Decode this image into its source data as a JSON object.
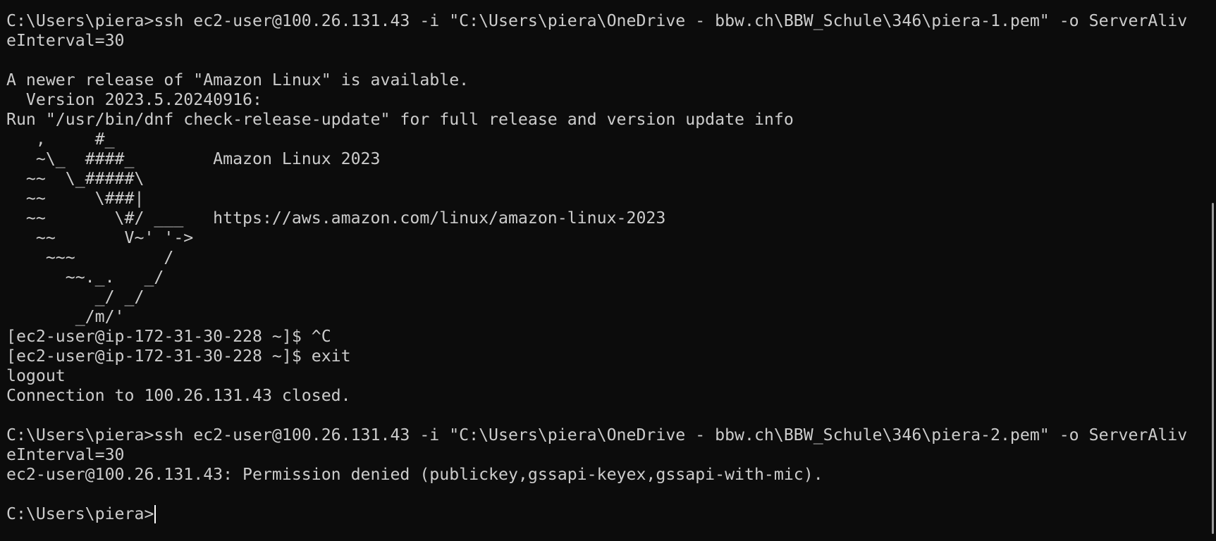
{
  "terminal": {
    "lines": [
      "C:\\Users\\piera>ssh ec2-user@100.26.131.43 -i \"C:\\Users\\piera\\OneDrive - bbw.ch\\BBW_Schule\\346\\piera-1.pem\" -o ServerAliv",
      "eInterval=30",
      "",
      "A newer release of \"Amazon Linux\" is available.",
      "  Version 2023.5.20240916:",
      "Run \"/usr/bin/dnf check-release-update\" for full release and version update info",
      "   ,     #_",
      "   ~\\_  ####_        Amazon Linux 2023",
      "  ~~  \\_#####\\",
      "  ~~     \\###|",
      "  ~~       \\#/ ___   https://aws.amazon.com/linux/amazon-linux-2023",
      "   ~~       V~' '->",
      "    ~~~         /",
      "      ~~._.   _/",
      "         _/ _/",
      "       _/m/'",
      "[ec2-user@ip-172-31-30-228 ~]$ ^C",
      "[ec2-user@ip-172-31-30-228 ~]$ exit",
      "logout",
      "Connection to 100.26.131.43 closed.",
      "",
      "C:\\Users\\piera>ssh ec2-user@100.26.131.43 -i \"C:\\Users\\piera\\OneDrive - bbw.ch\\BBW_Schule\\346\\piera-2.pem\" -o ServerAliv",
      "eInterval=30",
      "ec2-user@100.26.131.43: Permission denied (publickey,gssapi-keyex,gssapi-with-mic).",
      ""
    ],
    "prompt": "C:\\Users\\piera>"
  },
  "colors": {
    "background": "#0c0c0c",
    "foreground": "#cccccc",
    "cursor": "#ffffff",
    "scrollbar": "#9a9a9a"
  }
}
